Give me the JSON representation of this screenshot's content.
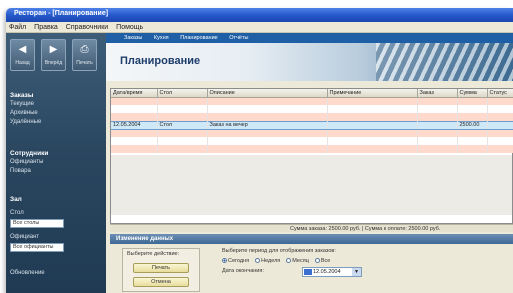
{
  "window": {
    "title": "Ресторан - [Планирование]"
  },
  "menu": [
    "Файл",
    "Правка",
    "Справочники",
    "Помощь"
  ],
  "toolbar": [
    {
      "icon": "back-arrow-icon",
      "label": "Назад"
    },
    {
      "icon": "forward-arrow-icon",
      "label": "Вперёд"
    },
    {
      "icon": "printer-icon",
      "label": "Печать"
    }
  ],
  "sidebar": {
    "groups": [
      {
        "header": "Заказы",
        "items": [
          "Текущие",
          "Архивные",
          "Удалённые"
        ]
      },
      {
        "header": "Сотрудники",
        "items": [
          "Официанты",
          "Повара"
        ]
      },
      {
        "header": "Зал",
        "items": [
          "Стол"
        ]
      }
    ],
    "fields": [
      {
        "label": "Стол",
        "value": "Все столы"
      },
      {
        "label": "Официант",
        "value": "Все официанты"
      }
    ],
    "footer": "Обновление"
  },
  "navstrip": [
    "Заказы",
    "Кухня",
    "Планирование",
    "Отчёты"
  ],
  "banner": {
    "title": "Планирование"
  },
  "grid": {
    "columns": [
      "Дата/время",
      "Стол",
      "Описание",
      "Примечание",
      "Заказ",
      "Сумма",
      "Статус"
    ],
    "rows": [
      [
        "",
        "",
        "",
        "",
        "",
        "",
        ""
      ],
      [
        "",
        "",
        "",
        "",
        "",
        "",
        ""
      ],
      [
        "",
        "",
        "",
        "",
        "",
        "",
        ""
      ],
      [
        "12.05.2004",
        "Стол",
        "Заказ на вечер",
        "",
        "",
        "2500.00",
        ""
      ],
      [
        "",
        "",
        "",
        "",
        "",
        "",
        ""
      ],
      [
        "",
        "",
        "",
        "",
        "",
        "",
        ""
      ],
      [
        "",
        "",
        "",
        "",
        "",
        "",
        ""
      ]
    ],
    "selected_row": 3,
    "status": "Сумма заказа: 2500.00 руб. | Сумма к оплате: 2500.00 руб."
  },
  "bottom": {
    "header": "Изменение данных",
    "group_label": "Выберите действие:",
    "buttons": [
      "Печать",
      "Отмена"
    ],
    "filter_text": "Выберите период для отображения заказов:",
    "radios": [
      {
        "label": "Сегодня",
        "on": true
      },
      {
        "label": "Неделя",
        "on": false
      },
      {
        "label": "Месяц",
        "on": false
      },
      {
        "label": "Все",
        "on": false
      }
    ],
    "date_label": "Дата окончания:",
    "date_value": "12.05.2004"
  },
  "colors": {
    "title_bar": "#2457c8",
    "sidebar": "#2b4760",
    "selected_row": "#cfe8f8",
    "highlight_row": "#ffd9cc"
  }
}
